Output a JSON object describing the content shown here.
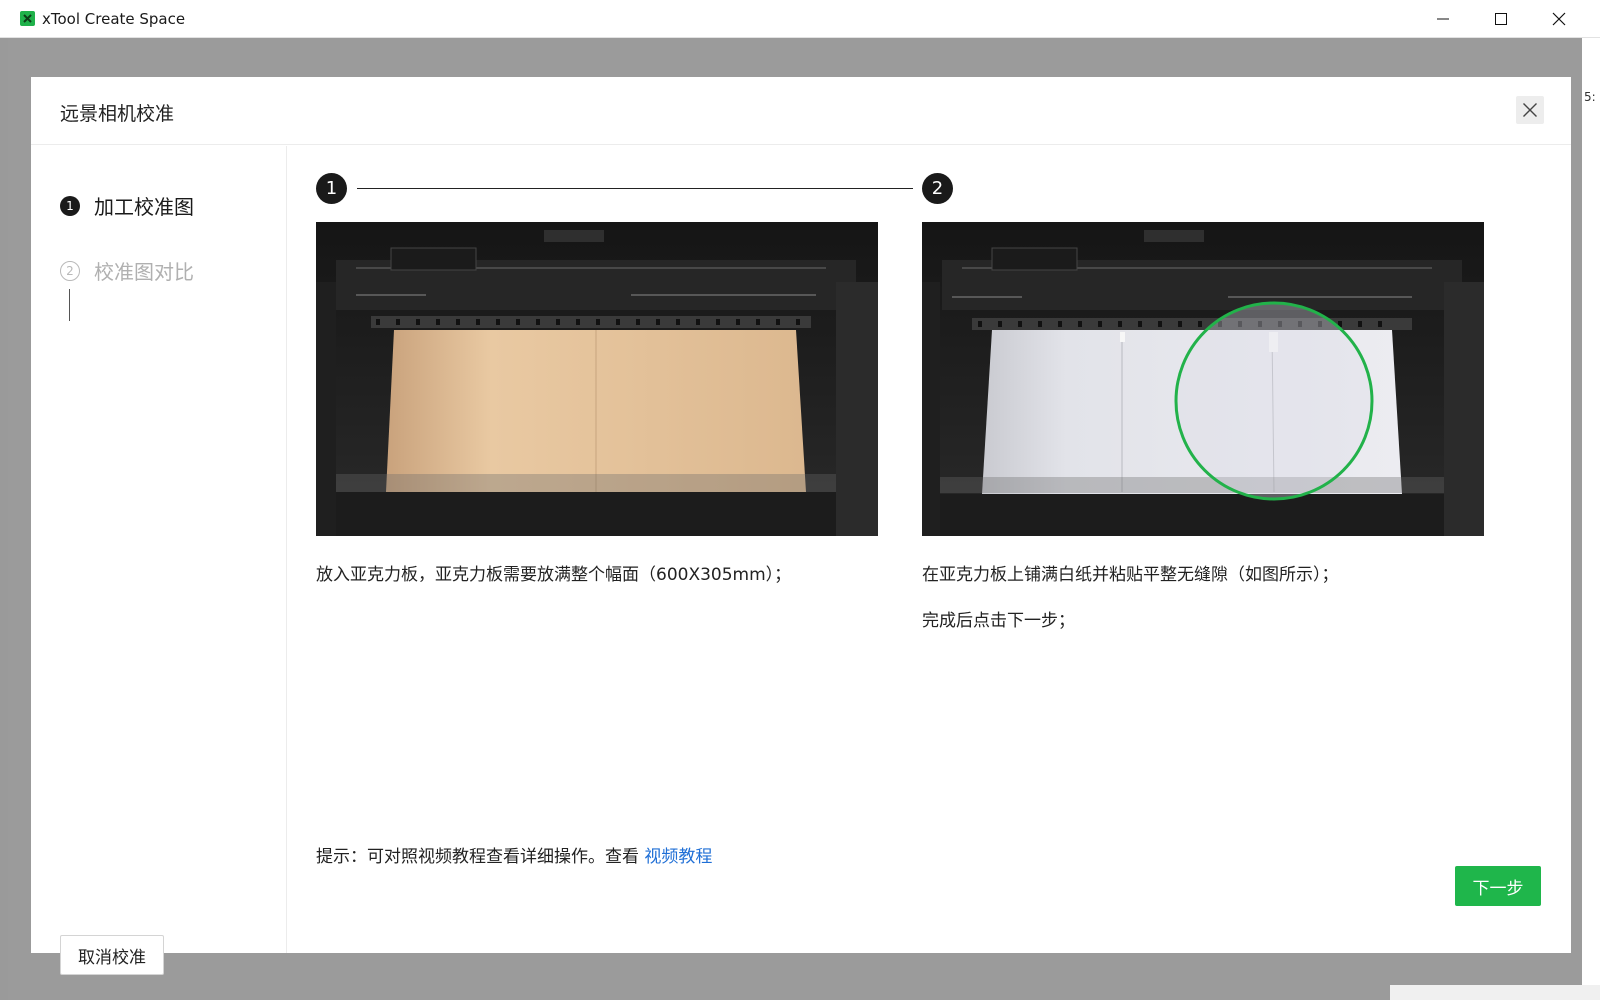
{
  "window": {
    "title": "xTool Create Space",
    "app_icon": "xtool-logo-icon",
    "controls": [
      "minimize-icon",
      "maximize-icon",
      "close-icon"
    ],
    "right_edge_text": "5:"
  },
  "dialog": {
    "title": "远景相机校准",
    "close_icon": "close-icon",
    "steps": [
      {
        "number": "1",
        "label": "加工校准图",
        "state": "active"
      },
      {
        "number": "2",
        "label": "校准图对比",
        "state": "inactive"
      }
    ],
    "cancel_label": "取消校准",
    "next_label": "下一步",
    "markers": [
      "1",
      "2"
    ],
    "captions": {
      "step1": "放入亚克力板，亚克力板需要放满整个幅面（600X305mm）；",
      "step2_line1": "在亚克力板上铺满白纸并粘贴平整无缝隙（如图所示）；",
      "step2_line2": "完成后点击下一步；"
    },
    "hint": {
      "text": "提示：可对照视频教程查看详细操作。查看 ",
      "link": "视频教程"
    }
  },
  "colors": {
    "accent_green": "#1fb64b",
    "link_blue": "#1f6fd6",
    "highlight_circle": "#22b24a"
  }
}
